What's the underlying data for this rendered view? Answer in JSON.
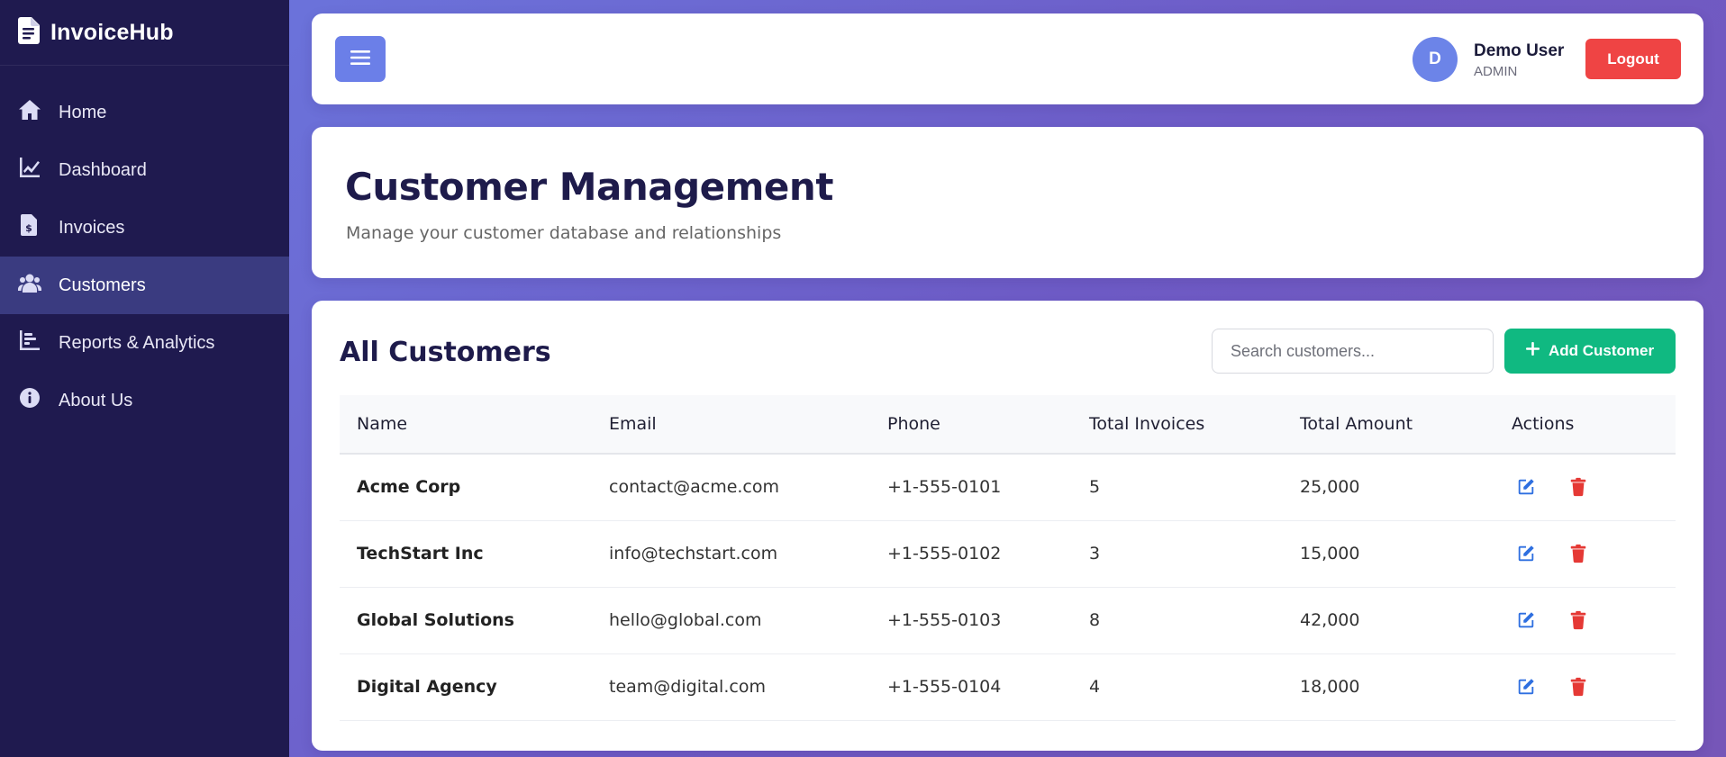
{
  "app": {
    "name": "InvoiceHub"
  },
  "sidebar": {
    "items": [
      {
        "label": "Home",
        "icon": "home-icon",
        "active": false
      },
      {
        "label": "Dashboard",
        "icon": "chart-line-icon",
        "active": false
      },
      {
        "label": "Invoices",
        "icon": "invoice-icon",
        "active": false
      },
      {
        "label": "Customers",
        "icon": "users-icon",
        "active": true
      },
      {
        "label": "Reports & Analytics",
        "icon": "bar-chart-icon",
        "active": false
      },
      {
        "label": "About Us",
        "icon": "info-icon",
        "active": false
      }
    ]
  },
  "topbar": {
    "avatar_initial": "D",
    "user_name": "Demo User",
    "user_role": "ADMIN",
    "logout_label": "Logout"
  },
  "header": {
    "title": "Customer Management",
    "subtitle": "Manage your customer database and relationships"
  },
  "customers": {
    "title": "All Customers",
    "search_placeholder": "Search customers...",
    "add_label": "Add Customer",
    "columns": [
      "Name",
      "Email",
      "Phone",
      "Total Invoices",
      "Total Amount",
      "Actions"
    ],
    "rows": [
      {
        "name": "Acme Corp",
        "email": "contact@acme.com",
        "phone": "+1-555-0101",
        "invoices": "5",
        "amount": "25,000"
      },
      {
        "name": "TechStart Inc",
        "email": "info@techstart.com",
        "phone": "+1-555-0102",
        "invoices": "3",
        "amount": "15,000"
      },
      {
        "name": "Global Solutions",
        "email": "hello@global.com",
        "phone": "+1-555-0103",
        "invoices": "8",
        "amount": "42,000"
      },
      {
        "name": "Digital Agency",
        "email": "team@digital.com",
        "phone": "+1-555-0104",
        "invoices": "4",
        "amount": "18,000"
      }
    ]
  },
  "colors": {
    "sidebar_bg": "#1f1a4f",
    "accent": "#6b7fe8",
    "danger": "#ef4444",
    "success": "#10b981"
  }
}
